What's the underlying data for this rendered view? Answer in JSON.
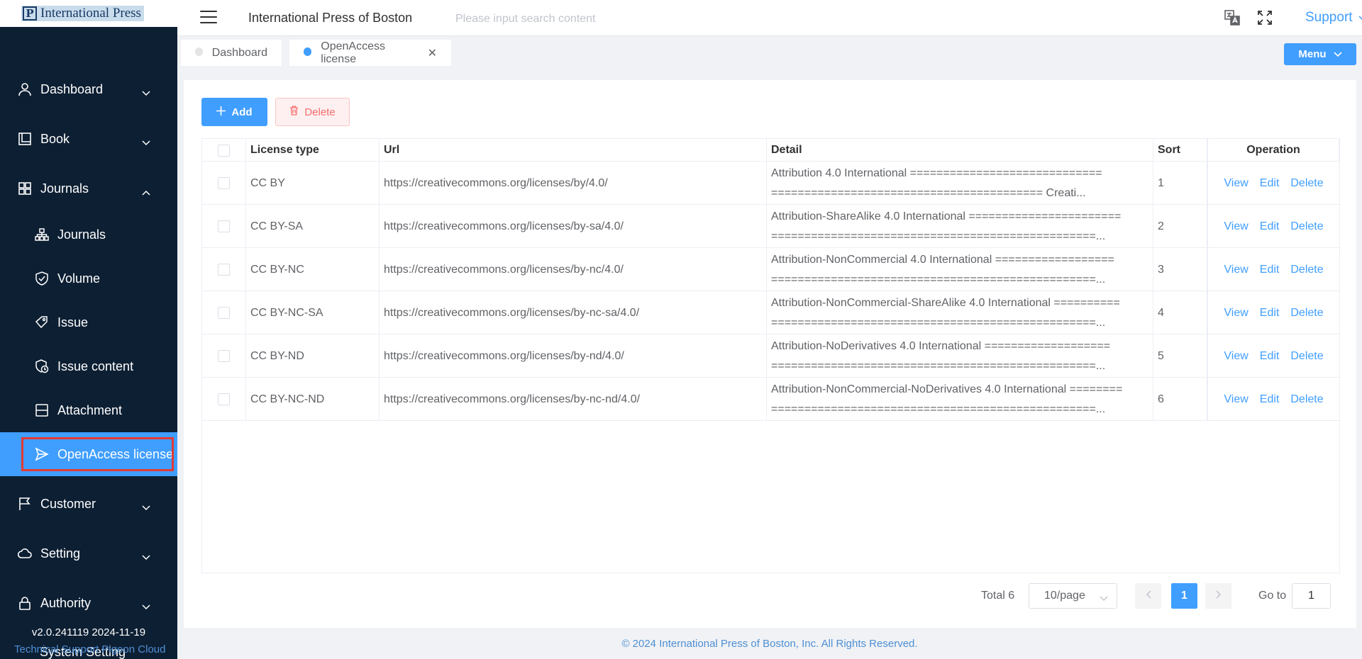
{
  "logo": {
    "mark": "P",
    "text": "International Press"
  },
  "sidebar": {
    "menu": [
      {
        "label": "Dashboard",
        "icon": "user-icon"
      },
      {
        "label": "Book",
        "icon": "book-icon"
      },
      {
        "label": "Journals",
        "icon": "grid-icon"
      }
    ],
    "journals_children": [
      {
        "label": "Journals",
        "icon": "sitemap-icon"
      },
      {
        "label": "Volume",
        "icon": "shield-check-icon"
      },
      {
        "label": "Issue",
        "icon": "tag-icon"
      },
      {
        "label": "Issue content",
        "icon": "shield-clock-icon"
      },
      {
        "label": "Attachment",
        "icon": "layout-icon"
      },
      {
        "label": "OpenAccess license",
        "icon": "send-icon"
      }
    ],
    "menu_bottom": [
      {
        "label": "Customer",
        "icon": "flag-icon"
      },
      {
        "label": "Setting",
        "icon": "cloud-icon"
      },
      {
        "label": "Authority",
        "icon": "lock-icon"
      }
    ],
    "version": "v2.0.241119 2024-11-19",
    "technical_support": "Technical Support Pigeon Cloud",
    "system_setting": "System Setting"
  },
  "header": {
    "title": "International Press of Boston",
    "search_placeholder": "Please input search content",
    "support_label": "Support"
  },
  "tabs": [
    {
      "label": "Dashboard",
      "active": false
    },
    {
      "label": "OpenAccess license",
      "active": true
    }
  ],
  "menu_button": "Menu",
  "toolbar": {
    "add_label": "Add",
    "delete_label": "Delete"
  },
  "table": {
    "columns": [
      "License type",
      "Url",
      "Detail",
      "Sort",
      "Operation"
    ],
    "operations": [
      "View",
      "Edit",
      "Delete"
    ],
    "rows": [
      {
        "type": "CC BY",
        "url": "https://creativecommons.org/licenses/by/4.0/",
        "detail_line1": "Attribution 4.0 International =============================",
        "detail_line2": "========================================= Creati...",
        "sort": "1"
      },
      {
        "type": "CC BY-SA",
        "url": "https://creativecommons.org/licenses/by-sa/4.0/",
        "detail_line1": "Attribution-ShareAlike 4.0 International =======================",
        "detail_line2": "=================================================...",
        "sort": "2"
      },
      {
        "type": "CC BY-NC",
        "url": "https://creativecommons.org/licenses/by-nc/4.0/",
        "detail_line1": "Attribution-NonCommercial 4.0 International ==================",
        "detail_line2": "=================================================...",
        "sort": "3"
      },
      {
        "type": "CC BY-NC-SA",
        "url": "https://creativecommons.org/licenses/by-nc-sa/4.0/",
        "detail_line1": "Attribution-NonCommercial-ShareAlike 4.0 International ==========",
        "detail_line2": "=================================================...",
        "sort": "4"
      },
      {
        "type": "CC BY-ND",
        "url": "https://creativecommons.org/licenses/by-nd/4.0/",
        "detail_line1": "Attribution-NoDerivatives 4.0 International ===================",
        "detail_line2": "=================================================...",
        "sort": "5"
      },
      {
        "type": "CC BY-NC-ND",
        "url": "https://creativecommons.org/licenses/by-nc-nd/4.0/",
        "detail_line1": "Attribution-NonCommercial-NoDerivatives 4.0 International ========",
        "detail_line2": "=================================================...",
        "sort": "6"
      }
    ]
  },
  "pagination": {
    "total_label": "Total 6",
    "page_size": "10/page",
    "current_page": "1",
    "goto_label": "Go to",
    "goto_value": "1"
  },
  "footer": "© 2024 International Press of Boston, Inc. All Rights Reserved.",
  "colors": {
    "primary": "#409eff",
    "sidebar_bg": "#0d1f33",
    "danger": "#f56c6c"
  }
}
